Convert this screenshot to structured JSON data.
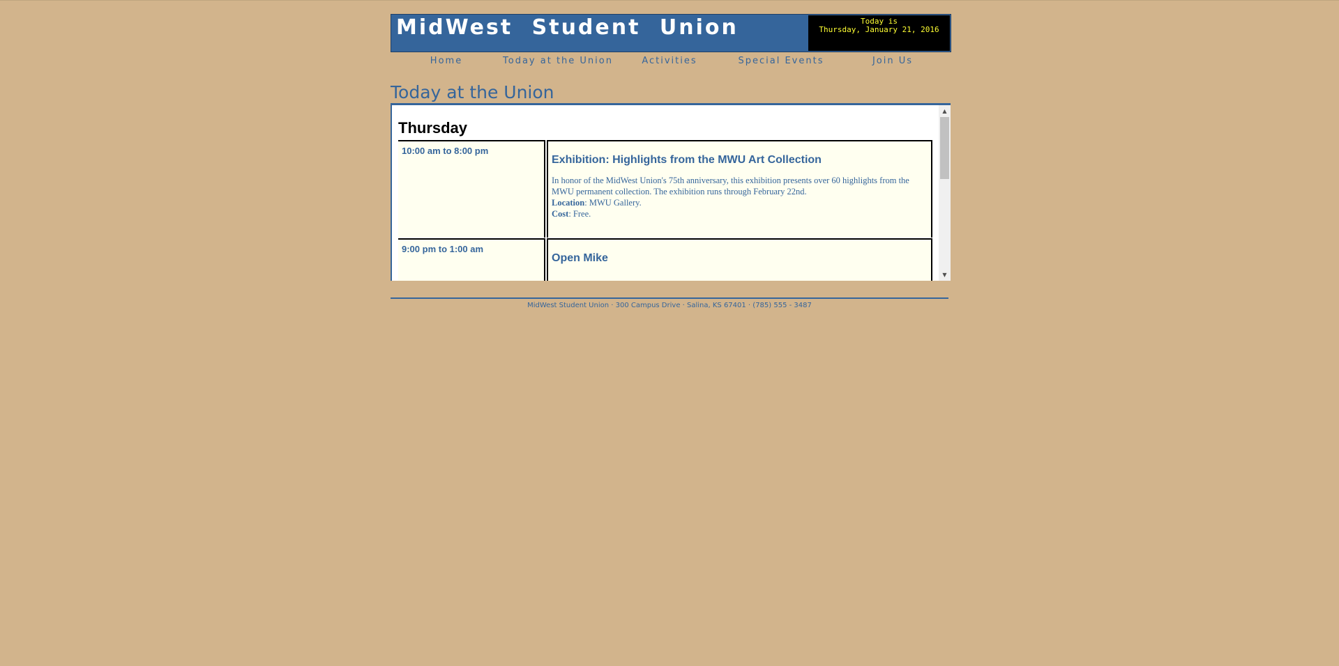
{
  "header": {
    "site_title": "MidWest Student Union",
    "date_label": "Today is",
    "date_value": "Thursday, January 21, 2016"
  },
  "nav": {
    "items": [
      {
        "label": "Home"
      },
      {
        "label": "Today at the Union"
      },
      {
        "label": "Activities"
      },
      {
        "label": "Special Events"
      },
      {
        "label": "Join Us"
      }
    ]
  },
  "main": {
    "heading": "Today at the Union",
    "day_heading": "Thursday",
    "events": [
      {
        "time": "10:00 am to 8:00 pm",
        "title": "Exhibition: Highlights from the MWU Art Collection",
        "description": "In honor of the MidWest Union's 75th anniversary, this exhibition presents over 60 highlights from the MWU permanent collection. The exhibition runs through February 22nd.",
        "location_label": "Location",
        "location": ": MWU Gallery.",
        "cost_label": "Cost",
        "cost": ": Free."
      },
      {
        "time": "9:00 pm to 1:00 am",
        "title": "Open Mike"
      }
    ]
  },
  "footer": {
    "text": "MidWest Student Union · 300 Campus Drive · Salina, KS 67401 · (785) 555 - 3487"
  },
  "colors": {
    "page_background": "#d2b48c",
    "brand_blue": "#35659b",
    "date_box_bg": "#000000",
    "date_text": "#ffff33",
    "event_cell_bg": "#fffff0"
  }
}
